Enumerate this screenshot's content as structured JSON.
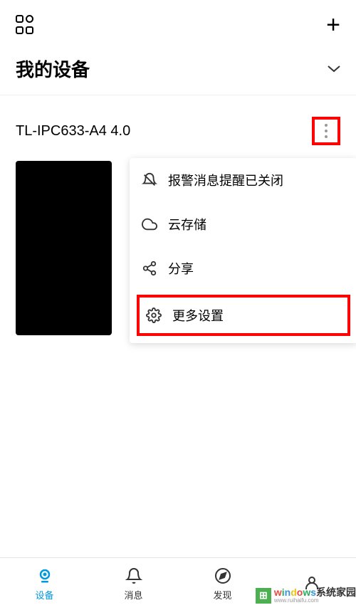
{
  "header": {
    "title": "我的设备"
  },
  "device": {
    "name": "TL-IPC633-A4 4.0"
  },
  "menu": {
    "items": [
      {
        "icon": "bell-off-icon",
        "label": "报警消息提醒已关闭"
      },
      {
        "icon": "cloud-icon",
        "label": "云存储"
      },
      {
        "icon": "share-icon",
        "label": "分享"
      },
      {
        "icon": "settings-icon",
        "label": "更多设置"
      }
    ]
  },
  "nav": {
    "items": [
      {
        "icon": "device-icon",
        "label": "设备",
        "active": true
      },
      {
        "icon": "message-icon",
        "label": "消息",
        "active": false
      },
      {
        "icon": "discover-icon",
        "label": "发现",
        "active": false
      },
      {
        "icon": "profile-icon",
        "label": "",
        "active": false
      }
    ]
  },
  "watermark": {
    "main": "windows系统家园",
    "sub": "www.ruihaifu.com"
  }
}
